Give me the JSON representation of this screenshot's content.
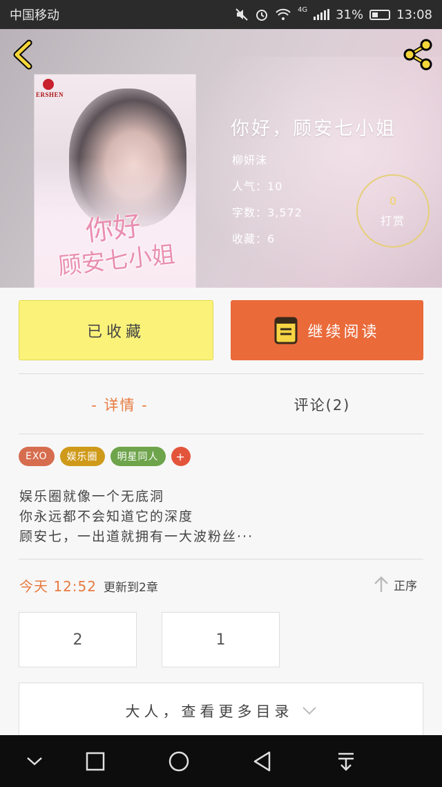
{
  "status_bar": {
    "carrier": "中国移动",
    "network": "4G",
    "battery": "31%",
    "time": "13:08",
    "icons": [
      "mute-icon",
      "alarm-icon",
      "wifi-icon",
      "signal-icon",
      "battery-icon"
    ]
  },
  "header": {
    "back_icon": "chevron-left-icon",
    "share_icon": "share-icon",
    "accent_color": "#f5d63a"
  },
  "cover": {
    "publisher": "ERSHEN",
    "title_art": "你好顾安七小姐",
    "title_line1": "你好",
    "title_line2": "顾安七小姐"
  },
  "book": {
    "title": "你好，顾安七小姐",
    "author": "柳妍沫",
    "popularity_label": "人气：",
    "popularity": "10",
    "wordcount_label": "字数：",
    "wordcount": "3,572",
    "favorites_label": "收藏：",
    "favorites": "6"
  },
  "tip": {
    "count": "0",
    "label": "打赏"
  },
  "actions": {
    "collected_label": "已收藏",
    "read_label": "继续阅读",
    "collected_color": "#fbf27a",
    "read_color": "#ea6a3a"
  },
  "tabs": {
    "detail": "- 详情 -",
    "comments": "评论(2)",
    "active": "detail"
  },
  "tags": {
    "items": [
      "EXO",
      "娱乐圈",
      "明星同人"
    ],
    "add_label": "+"
  },
  "synopsis": {
    "lines": [
      "娱乐圈就像一个无底洞",
      "你永远都不会知道它的深度",
      "顾安七，一出道就拥有一大波粉丝···"
    ]
  },
  "update": {
    "time": "今天 12:52",
    "text": "更新到2章",
    "sort_label": "正序"
  },
  "chapters": [
    "2",
    "1"
  ],
  "more_toc": {
    "label": "大人，查看更多目录"
  },
  "navbar": {
    "icons": [
      "hide-bar-icon",
      "recent-apps-icon",
      "home-icon",
      "back-icon",
      "notification-pull-icon"
    ]
  }
}
